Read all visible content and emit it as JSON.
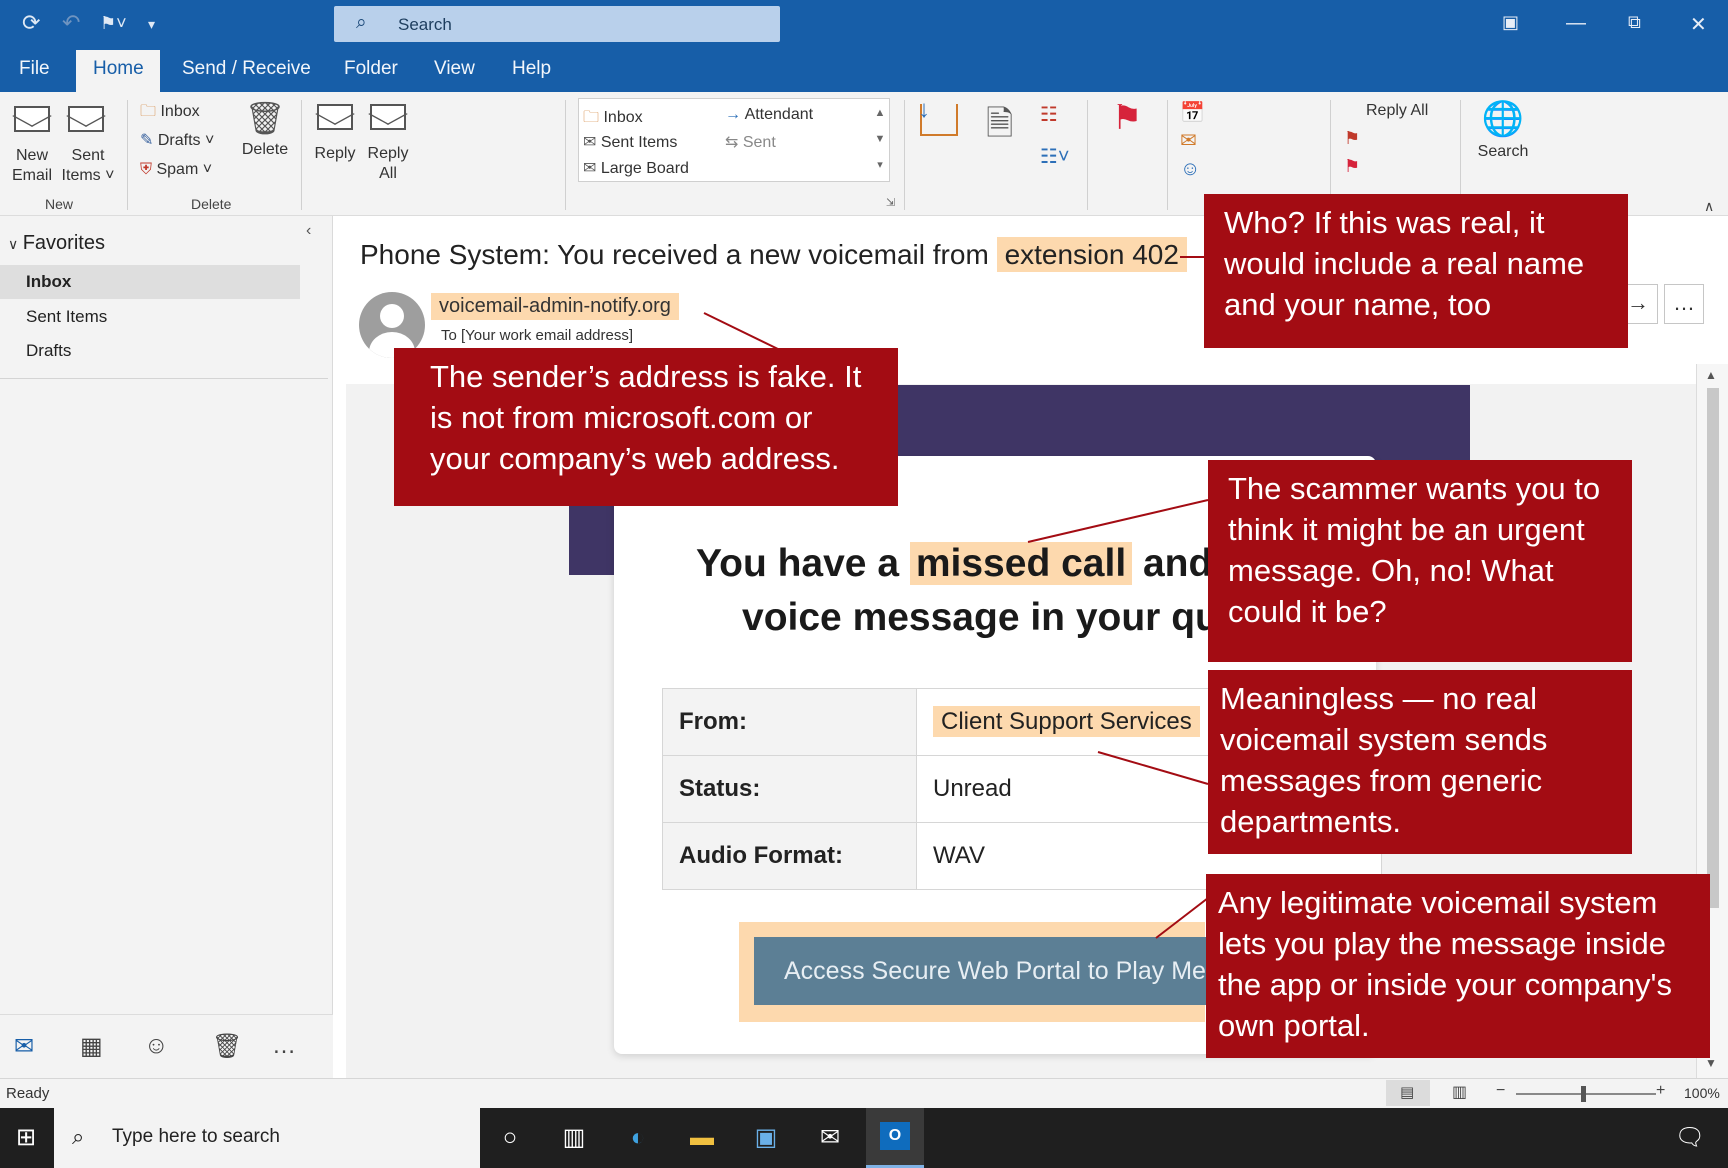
{
  "titlebar": {
    "search_placeholder": "Search",
    "icons": [
      "sync-icon",
      "undo-icon",
      "quick-step-icon",
      "customize-icon",
      "ribbon-display-icon",
      "minimize-icon",
      "restore-icon",
      "close-icon"
    ]
  },
  "menu": {
    "tabs": [
      "File",
      "Home",
      "Send / Receive",
      "Folder",
      "View",
      "Help"
    ],
    "active": "Home"
  },
  "ribbon": {
    "new_email": "New\nEmail",
    "new_email_l1": "New",
    "new_email_l2": "Email",
    "sent_items_l1": "Sent",
    "sent_items_l2": "Items ˅",
    "group_new": "New",
    "inbox": "Inbox",
    "drafts": "Drafts ˅",
    "spam": "Spam ˅",
    "delete": "Delete",
    "group_delete": "Delete",
    "reply": "Reply",
    "reply_all_l1": "Reply",
    "reply_all_l2": "All",
    "quick_steps": {
      "left": [
        "Inbox",
        "Sent Items",
        "Large Board"
      ],
      "right": [
        "Attendant",
        "Sent"
      ]
    },
    "reply_all_small": "Reply All",
    "search": "Search"
  },
  "nav": {
    "favorites": "Favorites",
    "items": [
      "Inbox",
      "Sent Items",
      "Drafts"
    ],
    "selected": "Inbox"
  },
  "email": {
    "subject_prefix": "Phone System: You received a new voicemail from ",
    "subject_highlight": "extension 402",
    "sender": "voicemail-admin-notify.org",
    "to": "To [Your work email address]",
    "headline_pre": "You have a ",
    "headline_hl": "missed call",
    "headline_post": " and",
    "headline_line2": "voice message in your qu",
    "table": [
      {
        "key": "From:",
        "value": "Client Support Services"
      },
      {
        "key": "Status:",
        "value": "Unread"
      },
      {
        "key": "Audio Format:",
        "value": "WAV"
      }
    ],
    "button": "Access Secure Web Portal to Play Mess"
  },
  "callouts": {
    "who": "Who? If this was real, it would include a real name and your name, too",
    "sender": "The sender’s address is fake. It is not from microsoft.com or your company’s web address.",
    "urgent": "The scammer wants you to think it might be an urgent message. Oh, no! What could it be?",
    "meaningless": "Meaningless — no real voicemail system sends messages from generic departments.",
    "legit": "Any legitimate voicemail system lets you play the message inside the app or inside your company's own portal."
  },
  "status": {
    "ready": "Ready",
    "zoom": "100%"
  },
  "taskbar": {
    "search_placeholder": "Type here to search"
  },
  "colors": {
    "outlook_blue": "#175ea8",
    "callout_red": "#a30c13",
    "highlight": "#fdd9ae",
    "purple_band": "#3f3565",
    "button": "#5c7f95"
  }
}
